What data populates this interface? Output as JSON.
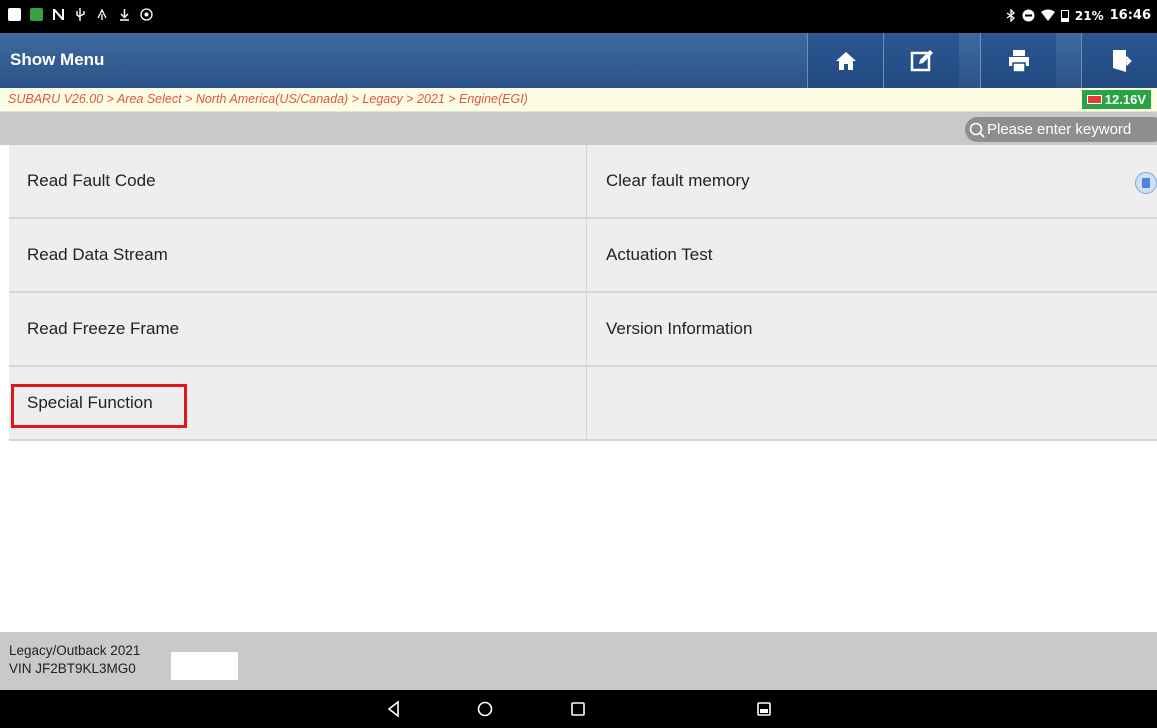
{
  "status_bar": {
    "time": "16:46",
    "battery_percent": "21%",
    "icons_left": [
      "image-icon",
      "app-icon",
      "n-icon",
      "usb-icon",
      "android-debug-icon",
      "download-icon",
      "app2-icon"
    ],
    "icons_right": [
      "bluetooth-icon",
      "dnd-icon",
      "wifi-icon",
      "battery-icon"
    ]
  },
  "header": {
    "title": "Show Menu",
    "buttons": [
      "home-icon",
      "edit-icon",
      "print-icon",
      "exit-icon"
    ]
  },
  "breadcrumb": {
    "text": "SUBARU V26.00 > Area Select > North America(US/Canada) > Legacy > 2021 > Engine(EGI)",
    "battery_voltage": "12.16V"
  },
  "search": {
    "placeholder": "Please enter keyword"
  },
  "menu": {
    "items": [
      {
        "left": "Read Fault Code",
        "right": "Clear fault memory"
      },
      {
        "left": "Read Data Stream",
        "right": "Actuation Test"
      },
      {
        "left": "Read Freeze Frame",
        "right": "Version Information"
      },
      {
        "left": "Special Function",
        "right": ""
      }
    ],
    "highlighted_item": "Special Function"
  },
  "footer": {
    "vehicle": "Legacy/Outback 2021",
    "vin": "VIN JF2BT9KL3MG0"
  },
  "colors": {
    "header_blue": "#2c5387",
    "breadcrumb_text": "#e0553c",
    "battery_green": "#27a544",
    "highlight_red": "#e0161c"
  }
}
